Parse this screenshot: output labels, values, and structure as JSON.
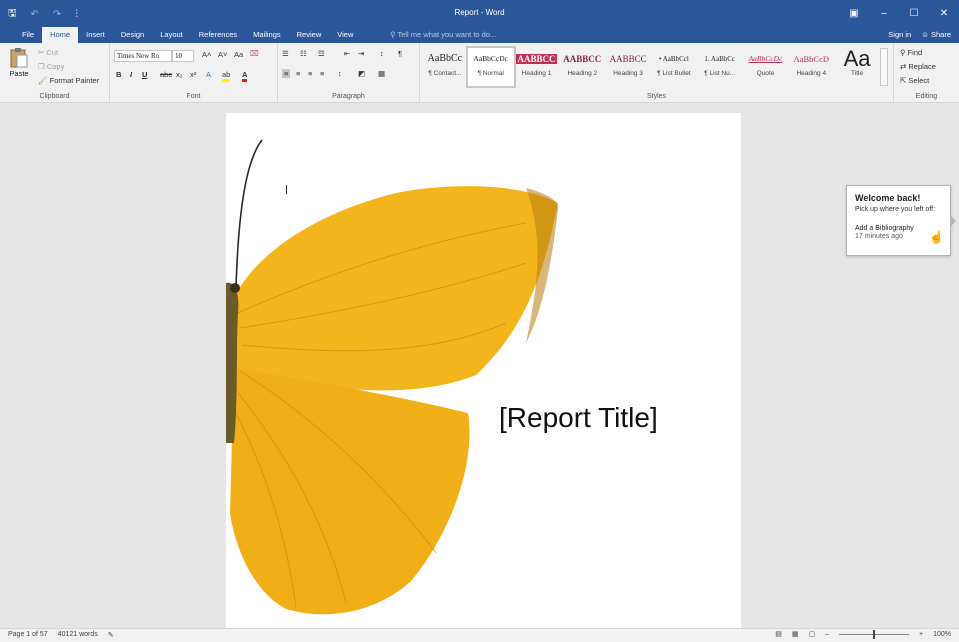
{
  "window": {
    "title": "Report - Word",
    "qat": {
      "save": "🖫",
      "undo": "↶",
      "redo": "↷",
      "customize": "⫶"
    },
    "controls": {
      "display": "▣",
      "minimize": "–",
      "maximize": "☐",
      "close": "✕"
    }
  },
  "tabs": [
    {
      "label": "File"
    },
    {
      "label": "Home"
    },
    {
      "label": "Insert"
    },
    {
      "label": "Design"
    },
    {
      "label": "Layout"
    },
    {
      "label": "References"
    },
    {
      "label": "Mailings"
    },
    {
      "label": "Review"
    },
    {
      "label": "View"
    }
  ],
  "tellme": "Tell me what you want to do...",
  "account": {
    "signin": "Sign in",
    "share": "Share"
  },
  "ribbon": {
    "clipboard": {
      "label": "Clipboard",
      "paste": "Paste",
      "cut": "Cut",
      "copy": "Copy",
      "format_painter": "Format Painter"
    },
    "font": {
      "label": "Font",
      "family": "Times New Ro",
      "size": "10",
      "grow": "A˄",
      "shrink": "A˅",
      "case": "Aa",
      "clear": "⌧",
      "bold": "B",
      "italic": "I",
      "underline": "U",
      "strike": "abc",
      "subscript": "x₂",
      "superscript": "x²",
      "effects": "A",
      "highlight": "ab",
      "color": "A"
    },
    "paragraph": {
      "label": "Paragraph",
      "bullets": "☰",
      "numbering": "☷",
      "multilevel": "☲",
      "decrease_indent": "⇤",
      "increase_indent": "⇥",
      "sort": "↕",
      "pilcrow": "¶",
      "align_left": "≡",
      "center": "≡",
      "align_right": "≡",
      "justify": "≡",
      "line_spacing": "↕",
      "shading": "◩",
      "borders": "▦"
    },
    "styles": {
      "label": "Styles",
      "items": [
        {
          "sample": "AaBbCc",
          "name": "¶ Contact..."
        },
        {
          "sample": "AaBbCcDc",
          "name": "¶ Normal"
        },
        {
          "sample": "AABBCC",
          "name": "Heading 1"
        },
        {
          "sample": "AABBCC",
          "name": "Heading 2"
        },
        {
          "sample": "AABBCC",
          "name": "Heading 3"
        },
        {
          "sample": "• AaBbCcl",
          "name": "¶ List Bullet"
        },
        {
          "sample": "1. AaBbCc",
          "name": "¶ List Nu..."
        },
        {
          "sample": "AaBbCcDc",
          "name": "Quote"
        },
        {
          "sample": "AaBbCcD",
          "name": "Heading 4"
        },
        {
          "sample": "Aa",
          "name": "Title"
        }
      ]
    },
    "editing": {
      "label": "Editing",
      "find": "Find",
      "replace": "Replace",
      "select": "Select"
    }
  },
  "document": {
    "title_placeholder": "[Report Title]"
  },
  "welcome": {
    "title": "Welcome back!",
    "subtitle": "Pick up where you left off:",
    "item": "Add a Bibliography",
    "time": "17 minutes ago"
  },
  "status": {
    "page": "Page 1 of 57",
    "words": "40121 words",
    "zoom_level": "100%",
    "zoom_out": "–",
    "zoom_in": "+"
  },
  "colors": {
    "accent": "#2b579a",
    "heading1_bg": "#c0315a",
    "butterfly": "#f2b51c"
  }
}
